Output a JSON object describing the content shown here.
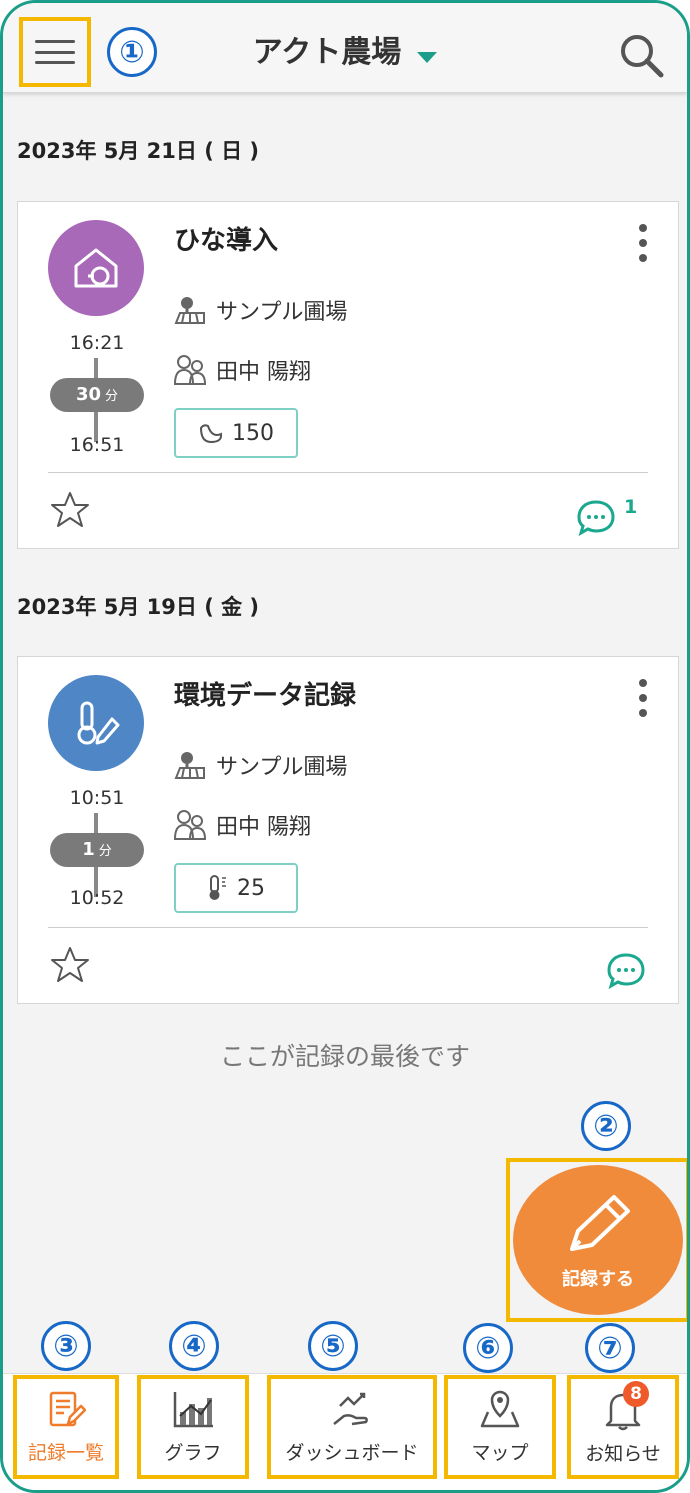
{
  "header": {
    "title": "アクト農場",
    "callout_menu": "①"
  },
  "records": [
    {
      "date": "2023年 5月 21日 ( 日 )",
      "title": "ひな導入",
      "location": "サンプル圃場",
      "person": "田中 陽翔",
      "start": "16:21",
      "end": "16:51",
      "duration_value": "30",
      "duration_unit": "分",
      "chip_value": "150",
      "comment_count": "1",
      "avatar_color": "#a86ab8",
      "icon": "chick-house-icon"
    },
    {
      "date": "2023年 5月 19日 ( 金 )",
      "title": "環境データ記録",
      "location": "サンプル圃場",
      "person": "田中 陽翔",
      "start": "10:51",
      "end": "10:52",
      "duration_value": "1",
      "duration_unit": "分",
      "chip_value": "25",
      "comment_count": "",
      "avatar_color": "#4f86c6",
      "icon": "thermometer-pencil-icon"
    }
  ],
  "end_message": "ここが記録の最後です",
  "fab": {
    "label": "記録する",
    "callout": "②",
    "color": "#ef8b3b"
  },
  "nav": [
    {
      "label": "記録一覧",
      "callout": "③",
      "active": true
    },
    {
      "label": "グラフ",
      "callout": "④"
    },
    {
      "label": "ダッシュボード",
      "callout": "⑤"
    },
    {
      "label": "マップ",
      "callout": "⑥"
    },
    {
      "label": "お知らせ",
      "callout": "⑦",
      "badge": "8"
    }
  ],
  "colors": {
    "accent": "#1a9e8a",
    "highlight": "#f5b800",
    "callout": "#1868c8",
    "active": "#ef7b2b"
  }
}
